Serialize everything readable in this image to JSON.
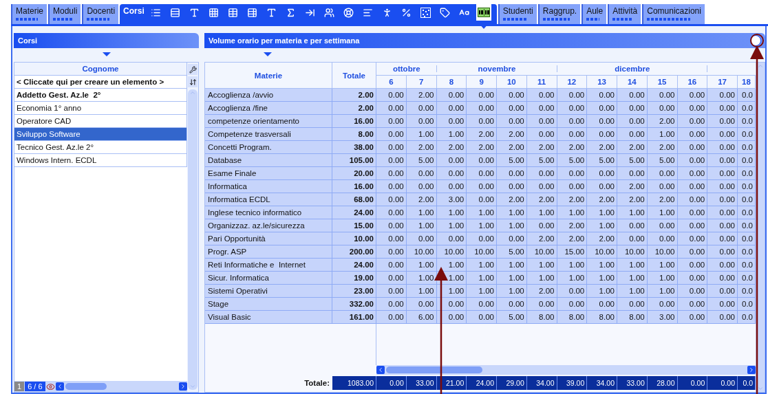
{
  "tabs": [
    {
      "label": "Materie",
      "selected": false
    },
    {
      "label": "Moduli",
      "selected": false
    },
    {
      "label": "Docenti",
      "selected": false
    },
    {
      "label": "Corsi",
      "selected": true
    },
    {
      "label": "Studenti",
      "selected": false
    },
    {
      "label": "Raggrup.",
      "selected": false
    },
    {
      "label": "Aule",
      "selected": false
    },
    {
      "label": "Attività",
      "selected": false
    },
    {
      "label": "Comunicazioni",
      "selected": false
    }
  ],
  "toolbar": {
    "icons": [
      {
        "kind": "list",
        "selected": false
      },
      {
        "kind": "binder",
        "selected": false
      },
      {
        "kind": "type",
        "selected": false
      },
      {
        "kind": "grid",
        "selected": false
      },
      {
        "kind": "table",
        "selected": false
      },
      {
        "kind": "tableprops",
        "selected": false
      },
      {
        "kind": "type",
        "selected": false
      },
      {
        "kind": "sigma",
        "selected": false
      },
      {
        "kind": "arrow",
        "selected": false
      },
      {
        "kind": "people",
        "selected": false
      },
      {
        "kind": "wheel",
        "selected": false
      },
      {
        "kind": "lines",
        "selected": false
      },
      {
        "kind": "person",
        "selected": false
      },
      {
        "kind": "percent",
        "selected": false
      },
      {
        "kind": "checker",
        "selected": false
      },
      {
        "kind": "tag",
        "selected": false
      },
      {
        "kind": "letters",
        "selected": false
      },
      {
        "kind": "score",
        "selected": true
      }
    ]
  },
  "courses_panel": {
    "title": "Corsi",
    "column": "Cognome",
    "new_row": "< Cliccate qui per creare un elemento >",
    "rows": [
      {
        "label": "Addetto Gest. Az.le  2°",
        "bold": true,
        "selected": false
      },
      {
        "label": "Economia 1° anno",
        "bold": false,
        "selected": false
      },
      {
        "label": "Operatore CAD",
        "bold": false,
        "selected": false
      },
      {
        "label": "Sviluppo Software",
        "bold": false,
        "selected": true
      },
      {
        "label": "Tecnico Gest. Az.le 2°",
        "bold": false,
        "selected": false
      },
      {
        "label": "Windows Intern. ECDL",
        "bold": false,
        "selected": false
      }
    ],
    "page": "1",
    "count": "6 / 6"
  },
  "hours_panel": {
    "title": "Volume orario per materia e per settimana",
    "subject_column": "Materie",
    "total_column": "Totale",
    "months": [
      {
        "label": "ottobre",
        "weeks": [
          "6",
          "7"
        ]
      },
      {
        "label": "novembre",
        "weeks": [
          "8",
          "9",
          "10",
          "11"
        ]
      },
      {
        "label": "dicembre",
        "weeks": [
          "12",
          "13",
          "14",
          "15",
          "16"
        ]
      },
      {
        "weeks": [
          "17",
          "18"
        ]
      }
    ],
    "rows": [
      {
        "subject": "Accoglienza /avvio",
        "total": "2.00",
        "weeks": [
          "0.00",
          "2.00",
          "0.00",
          "0.00",
          "0.00",
          "0.00",
          "0.00",
          "0.00",
          "0.00",
          "0.00",
          "0.00",
          "0.00",
          "0.0"
        ]
      },
      {
        "subject": "Accoglienza /fine",
        "total": "2.00",
        "weeks": [
          "0.00",
          "0.00",
          "0.00",
          "0.00",
          "0.00",
          "0.00",
          "0.00",
          "0.00",
          "0.00",
          "0.00",
          "0.00",
          "0.00",
          "0.0"
        ]
      },
      {
        "subject": "competenze orientamento",
        "total": "16.00",
        "weeks": [
          "0.00",
          "0.00",
          "0.00",
          "0.00",
          "0.00",
          "0.00",
          "0.00",
          "0.00",
          "0.00",
          "2.00",
          "0.00",
          "0.00",
          "0.0"
        ]
      },
      {
        "subject": "Competenze trasversali",
        "total": "8.00",
        "weeks": [
          "0.00",
          "1.00",
          "1.00",
          "2.00",
          "2.00",
          "0.00",
          "0.00",
          "0.00",
          "0.00",
          "1.00",
          "0.00",
          "0.00",
          "0.0"
        ]
      },
      {
        "subject": "Concetti Program.",
        "total": "38.00",
        "weeks": [
          "0.00",
          "2.00",
          "2.00",
          "2.00",
          "2.00",
          "2.00",
          "2.00",
          "2.00",
          "2.00",
          "2.00",
          "0.00",
          "0.00",
          "0.0"
        ]
      },
      {
        "subject": "Database",
        "total": "105.00",
        "weeks": [
          "0.00",
          "5.00",
          "0.00",
          "0.00",
          "5.00",
          "5.00",
          "5.00",
          "5.00",
          "5.00",
          "5.00",
          "0.00",
          "0.00",
          "0.0"
        ]
      },
      {
        "subject": "Esame Finale",
        "total": "20.00",
        "weeks": [
          "0.00",
          "0.00",
          "0.00",
          "0.00",
          "0.00",
          "0.00",
          "0.00",
          "0.00",
          "0.00",
          "0.00",
          "0.00",
          "0.00",
          "0.0"
        ]
      },
      {
        "subject": "Informatica",
        "total": "16.00",
        "weeks": [
          "0.00",
          "0.00",
          "0.00",
          "0.00",
          "0.00",
          "0.00",
          "0.00",
          "0.00",
          "2.00",
          "0.00",
          "0.00",
          "0.00",
          "0.0"
        ]
      },
      {
        "subject": "Informatica ECDL",
        "total": "68.00",
        "weeks": [
          "0.00",
          "2.00",
          "3.00",
          "0.00",
          "2.00",
          "2.00",
          "2.00",
          "2.00",
          "2.00",
          "2.00",
          "0.00",
          "0.00",
          "0.0"
        ]
      },
      {
        "subject": "Inglese tecnico informatico",
        "total": "24.00",
        "weeks": [
          "0.00",
          "1.00",
          "1.00",
          "1.00",
          "1.00",
          "1.00",
          "1.00",
          "1.00",
          "1.00",
          "1.00",
          "0.00",
          "0.00",
          "0.0"
        ]
      },
      {
        "subject": "Organizzaz. az.le/sicurezza",
        "total": "15.00",
        "weeks": [
          "0.00",
          "1.00",
          "1.00",
          "1.00",
          "1.00",
          "0.00",
          "2.00",
          "1.00",
          "0.00",
          "0.00",
          "0.00",
          "0.00",
          "0.0"
        ]
      },
      {
        "subject": "Pari Opportunità",
        "total": "10.00",
        "weeks": [
          "0.00",
          "0.00",
          "0.00",
          "0.00",
          "0.00",
          "2.00",
          "2.00",
          "2.00",
          "0.00",
          "0.00",
          "0.00",
          "0.00",
          "0.0"
        ]
      },
      {
        "subject": "Progr. ASP",
        "total": "200.00",
        "weeks": [
          "0.00",
          "10.00",
          "10.00",
          "10.00",
          "5.00",
          "10.00",
          "15.00",
          "10.00",
          "10.00",
          "10.00",
          "0.00",
          "0.00",
          "0.0"
        ]
      },
      {
        "subject": "Reti Informatiche e  Internet",
        "total": "24.00",
        "weeks": [
          "0.00",
          "1.00",
          "1.00",
          "1.00",
          "1.00",
          "1.00",
          "1.00",
          "1.00",
          "1.00",
          "1.00",
          "0.00",
          "0.00",
          "0.0"
        ]
      },
      {
        "subject": "Sicur. Informatica",
        "total": "19.00",
        "weeks": [
          "0.00",
          "1.00",
          "1.00",
          "1.00",
          "1.00",
          "1.00",
          "1.00",
          "1.00",
          "1.00",
          "1.00",
          "0.00",
          "0.00",
          "0.0"
        ]
      },
      {
        "subject": "Sistemi Operativi",
        "total": "23.00",
        "weeks": [
          "0.00",
          "1.00",
          "1.00",
          "1.00",
          "1.00",
          "2.00",
          "0.00",
          "1.00",
          "1.00",
          "1.00",
          "0.00",
          "0.00",
          "0.0"
        ]
      },
      {
        "subject": "Stage",
        "total": "332.00",
        "weeks": [
          "0.00",
          "0.00",
          "0.00",
          "0.00",
          "0.00",
          "0.00",
          "0.00",
          "0.00",
          "0.00",
          "0.00",
          "0.00",
          "0.00",
          "0.0"
        ]
      },
      {
        "subject": "Visual Basic",
        "total": "161.00",
        "weeks": [
          "0.00",
          "6.00",
          "0.00",
          "0.00",
          "5.00",
          "8.00",
          "8.00",
          "8.00",
          "8.00",
          "3.00",
          "0.00",
          "0.00",
          "0.0"
        ]
      }
    ],
    "totals": {
      "label": "Totale:",
      "total": "1083.00",
      "weeks": [
        "0.00",
        "33.00",
        "21.00",
        "24.00",
        "29.00",
        "34.00",
        "39.00",
        "34.00",
        "33.00",
        "28.00",
        "0.00",
        "0.00",
        "0.0"
      ]
    }
  }
}
